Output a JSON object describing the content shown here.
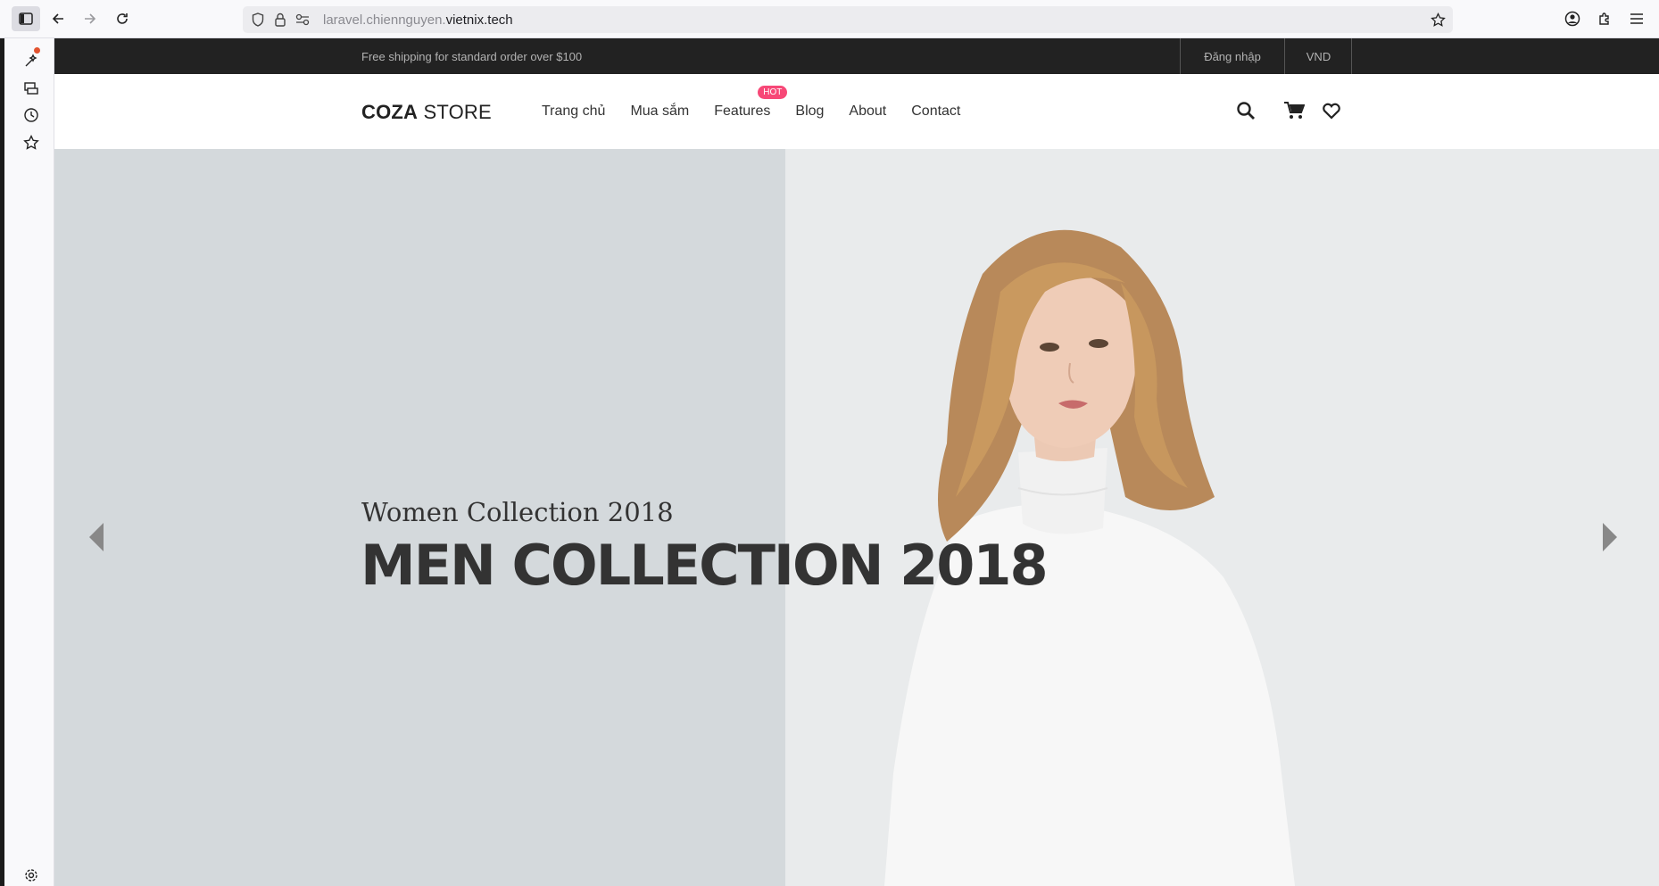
{
  "browser": {
    "url_prefix": "laravel.chiennguyen.",
    "url_domain": "vietnix.tech"
  },
  "site": {
    "topbar": {
      "shipping_text": "Free shipping for standard order over $100",
      "login_label": "Đăng nhập",
      "currency_label": "VND"
    },
    "header": {
      "logo_bold": "COZA",
      "logo_rest": " STORE",
      "menu": [
        {
          "label": "Trang chủ"
        },
        {
          "label": "Mua sắm"
        },
        {
          "label": "Features",
          "badge": "HOT"
        },
        {
          "label": "Blog"
        },
        {
          "label": "About"
        },
        {
          "label": "Contact"
        }
      ]
    },
    "hero": {
      "subtitle": "Women Collection 2018",
      "title": "MEN COLLECTION 2018"
    }
  },
  "colors": {
    "topbar_bg": "#222222",
    "badge": "#f74877",
    "hero_bg": "#d4d9dc"
  }
}
